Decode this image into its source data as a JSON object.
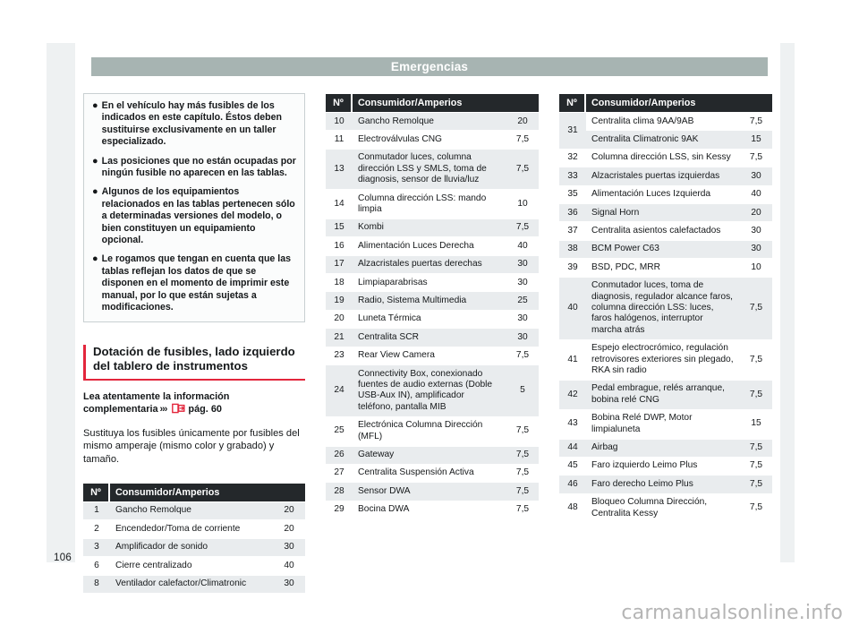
{
  "document": {
    "running_head": "Emergencias",
    "folio": "106",
    "watermark": "carmanualsonline.info"
  },
  "colors": {
    "accent_red": "#e3263c",
    "head_band": "#a7b4b2",
    "table_header": "#24282b",
    "row_shade": "#e9ecee"
  },
  "note_box": {
    "bullet": "●",
    "items": [
      "En el vehículo hay más fusibles de los indicados en este capítulo. Éstos deben sustituirse exclusivamente en un taller especializado.",
      "Las posiciones que no están ocupadas por ningún fusible no aparecen en las tablas.",
      "Algunos de los equipamientos relacionados en las tablas pertenecen sólo a determinadas versiones del modelo, o bien constituyen un equipamiento opcional.",
      "Le rogamos que tengan en cuenta que las tablas reflejan los datos de que se disponen en el momento de imprimir este manual, por lo que están sujetas a modificaciones."
    ]
  },
  "section": {
    "heading": "Dotación de fusibles, lado izquierdo del tablero de instrumentos",
    "lead_prefix": "Lea atentamente la información complementaria",
    "chevrons": "›››",
    "page_ref": "pág. 60",
    "body": "Sustituya los fusibles únicamente por fusibles del mismo amperaje (mismo color y grabado) y tamaño."
  },
  "tables": {
    "headers": {
      "num": "Nº",
      "consumer": "Consumidor/Amperios"
    },
    "left": {
      "rows": [
        {
          "num": "1",
          "consumer": "Gancho Remolque",
          "amp": "20"
        },
        {
          "num": "2",
          "consumer": "Encendedor/Toma de corriente",
          "amp": "20"
        },
        {
          "num": "3",
          "consumer": "Amplificador de sonido",
          "amp": "30"
        },
        {
          "num": "6",
          "consumer": "Cierre centralizado",
          "amp": "40"
        },
        {
          "num": "8",
          "consumer": "Ventilador calefactor/Climatronic",
          "amp": "30"
        }
      ]
    },
    "middle": {
      "rows": [
        {
          "num": "10",
          "consumer": "Gancho Remolque",
          "amp": "20"
        },
        {
          "num": "11",
          "consumer": "Electroválvulas CNG",
          "amp": "7,5"
        },
        {
          "num": "13",
          "consumer": "Conmutador luces, columna dirección LSS y SMLS, toma de diagnosis, sensor de lluvia/luz",
          "amp": "7,5"
        },
        {
          "num": "14",
          "consumer": "Columna dirección LSS: mando limpia",
          "amp": "10"
        },
        {
          "num": "15",
          "consumer": "Kombi",
          "amp": "7,5"
        },
        {
          "num": "16",
          "consumer": "Alimentación Luces Derecha",
          "amp": "40"
        },
        {
          "num": "17",
          "consumer": "Alzacristales puertas derechas",
          "amp": "30"
        },
        {
          "num": "18",
          "consumer": "Limpiaparabrisas",
          "amp": "30"
        },
        {
          "num": "19",
          "consumer": "Radio, Sistema Multimedia",
          "amp": "25"
        },
        {
          "num": "20",
          "consumer": "Luneta Térmica",
          "amp": "30"
        },
        {
          "num": "21",
          "consumer": "Centralita SCR",
          "amp": "30"
        },
        {
          "num": "23",
          "consumer": "Rear View Camera",
          "amp": "7,5"
        },
        {
          "num": "24",
          "consumer": "Connectivity Box, conexionado fuentes de audio externas (Doble USB-Aux IN), amplificador teléfono, pantalla MIB",
          "amp": "5"
        },
        {
          "num": "25",
          "consumer": "Electrónica Columna Dirección (MFL)",
          "amp": "7,5"
        },
        {
          "num": "26",
          "consumer": "Gateway",
          "amp": "7,5"
        },
        {
          "num": "27",
          "consumer": "Centralita Suspensión Activa",
          "amp": "7,5"
        },
        {
          "num": "28",
          "consumer": "Sensor DWA",
          "amp": "7,5"
        },
        {
          "num": "29",
          "consumer": "Bocina DWA",
          "amp": "7,5"
        }
      ]
    },
    "right": {
      "split_row": {
        "num": "31",
        "sub_rows": [
          {
            "consumer": "Centralita clima 9AA/9AB",
            "amp": "7,5"
          },
          {
            "consumer": "Centralita Climatronic 9AK",
            "amp": "15"
          }
        ]
      },
      "rows": [
        {
          "num": "32",
          "consumer": "Columna dirección LSS, sin Kessy",
          "amp": "7,5"
        },
        {
          "num": "33",
          "consumer": "Alzacristales puertas izquierdas",
          "amp": "30"
        },
        {
          "num": "35",
          "consumer": "Alimentación Luces Izquierda",
          "amp": "40"
        },
        {
          "num": "36",
          "consumer": "Signal Horn",
          "amp": "20"
        },
        {
          "num": "37",
          "consumer": "Centralita asientos calefactados",
          "amp": "30"
        },
        {
          "num": "38",
          "consumer": "BCM Power C63",
          "amp": "30"
        },
        {
          "num": "39",
          "consumer": "BSD, PDC, MRR",
          "amp": "10"
        },
        {
          "num": "40",
          "consumer": "Conmutador luces, toma de diagnosis, regulador alcance faros, columna dirección LSS: luces, faros halógenos, interruptor marcha atrás",
          "amp": "7,5"
        },
        {
          "num": "41",
          "consumer": "Espejo electrocrómico, regulación retrovisores exteriores sin plegado, RKA sin radio",
          "amp": "7,5"
        },
        {
          "num": "42",
          "consumer": "Pedal embrague, relés arranque, bobina relé CNG",
          "amp": "7,5"
        },
        {
          "num": "43",
          "consumer": "Bobina Relé DWP, Motor limpialuneta",
          "amp": "15"
        },
        {
          "num": "44",
          "consumer": "Airbag",
          "amp": "7,5"
        },
        {
          "num": "45",
          "consumer": "Faro izquierdo Leimo Plus",
          "amp": "7,5"
        },
        {
          "num": "46",
          "consumer": "Faro derecho Leimo Plus",
          "amp": "7,5"
        },
        {
          "num": "48",
          "consumer": "Bloqueo Columna Dirección, Centralita Kessy",
          "amp": "7,5"
        }
      ]
    }
  }
}
